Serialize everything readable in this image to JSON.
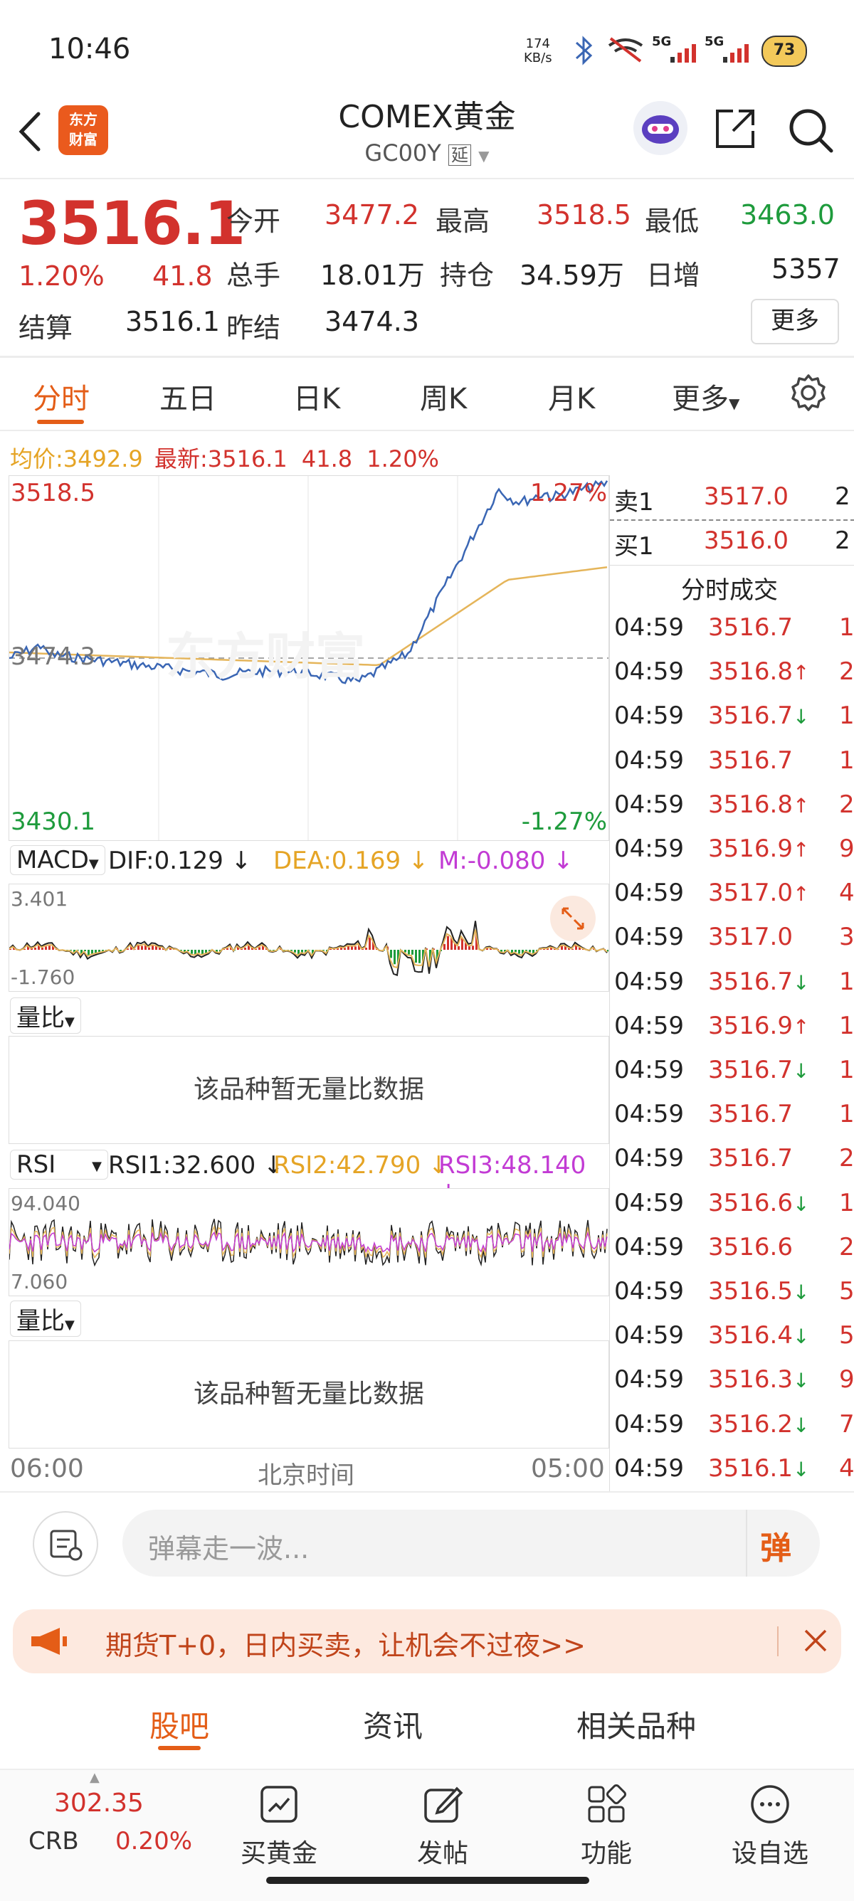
{
  "status_bar": {
    "time": "10:46",
    "net_speed_value": "174",
    "net_speed_unit": "KB/s",
    "signal1": "5G",
    "signal2": "5G",
    "battery": "73"
  },
  "header": {
    "logo_line1": "东方",
    "logo_line2": "财富",
    "title": "COMEX黄金",
    "code": "GC00Y",
    "delay_badge": "延"
  },
  "quote": {
    "price": "3516.1",
    "change_pct": "1.20%",
    "change": "41.8",
    "open_label": "今开",
    "open": "3477.2",
    "high_label": "最高",
    "high": "3518.5",
    "low_label": "最低",
    "low": "3463.0",
    "volume_label": "总手",
    "volume": "18.01万",
    "oi_label": "持仓",
    "oi": "34.59万",
    "daily_inc_label": "日增",
    "daily_inc": "5357",
    "settle_label": "结算",
    "settle": "3516.1",
    "prev_settle_label": "昨结",
    "prev_settle": "3474.3",
    "more_label": "更多"
  },
  "tabs": [
    "分时",
    "五日",
    "日K",
    "周K",
    "月K",
    "更多"
  ],
  "intraday": {
    "avg_label": "均价:",
    "avg": "3492.9",
    "latest_label": "最新:",
    "latest": "3516.1",
    "latest_change": "41.8",
    "latest_pct": "1.20%",
    "y_top": "3518.5",
    "y_mid": "3474.3",
    "y_bottom": "3430.1",
    "pct_top": "1.27%",
    "pct_bottom": "-1.27%",
    "watermark": "东方财富"
  },
  "macd": {
    "name": "MACD",
    "dif": "DIF:0.129",
    "dea": "DEA:0.169",
    "m": "M:-0.080",
    "y_top": "3.401",
    "y_bottom": "-1.760"
  },
  "volratio1": {
    "name": "量比",
    "empty": "该品种暂无量比数据"
  },
  "rsi": {
    "name": "RSI",
    "rsi1": "RSI1:32.600",
    "rsi2": "RSI2:42.790",
    "rsi3": "RSI3:48.140",
    "y_top": "94.040",
    "y_bottom": "7.060"
  },
  "volratio2": {
    "name": "量比",
    "empty": "该品种暂无量比数据"
  },
  "time_axis": {
    "start": "06:00",
    "label": "北京时间",
    "end": "05:00"
  },
  "order_book": {
    "ask_label": "卖1",
    "ask": "3517.0",
    "ask_qty": "2",
    "bid_label": "买1",
    "bid": "3516.0",
    "bid_qty": "2",
    "trades_title": "分时成交"
  },
  "trades": [
    {
      "t": "04:59",
      "p": "3516.7",
      "d": "",
      "q": "1"
    },
    {
      "t": "04:59",
      "p": "3516.8",
      "d": "up",
      "q": "2"
    },
    {
      "t": "04:59",
      "p": "3516.7",
      "d": "down",
      "q": "1"
    },
    {
      "t": "04:59",
      "p": "3516.7",
      "d": "",
      "q": "1"
    },
    {
      "t": "04:59",
      "p": "3516.8",
      "d": "up",
      "q": "2"
    },
    {
      "t": "04:59",
      "p": "3516.9",
      "d": "up",
      "q": "9"
    },
    {
      "t": "04:59",
      "p": "3517.0",
      "d": "up",
      "q": "4"
    },
    {
      "t": "04:59",
      "p": "3517.0",
      "d": "",
      "q": "3"
    },
    {
      "t": "04:59",
      "p": "3516.7",
      "d": "down",
      "q": "1"
    },
    {
      "t": "04:59",
      "p": "3516.9",
      "d": "up",
      "q": "1"
    },
    {
      "t": "04:59",
      "p": "3516.7",
      "d": "down",
      "q": "1"
    },
    {
      "t": "04:59",
      "p": "3516.7",
      "d": "",
      "q": "1"
    },
    {
      "t": "04:59",
      "p": "3516.7",
      "d": "",
      "q": "2"
    },
    {
      "t": "04:59",
      "p": "3516.6",
      "d": "down",
      "q": "1"
    },
    {
      "t": "04:59",
      "p": "3516.6",
      "d": "",
      "q": "2"
    },
    {
      "t": "04:59",
      "p": "3516.5",
      "d": "down",
      "q": "5"
    },
    {
      "t": "04:59",
      "p": "3516.4",
      "d": "down",
      "q": "5"
    },
    {
      "t": "04:59",
      "p": "3516.3",
      "d": "down",
      "q": "9"
    },
    {
      "t": "04:59",
      "p": "3516.2",
      "d": "down",
      "q": "7"
    },
    {
      "t": "04:59",
      "p": "3516.1",
      "d": "down",
      "q": "4"
    }
  ],
  "chat": {
    "placeholder": "弹幕走一波...",
    "send": "弹"
  },
  "banner": {
    "text": "期货T+0，日内买卖，让机会不过夜>>"
  },
  "bottom_tabs": [
    "股吧",
    "资讯",
    "相关品种"
  ],
  "bottom_nav": {
    "crb_value": "302.35",
    "crb_label": "CRB",
    "crb_pct": "0.20%",
    "buy_gold": "买黄金",
    "post": "发帖",
    "function": "功能",
    "watchlist": "设自选"
  },
  "colors": {
    "up": "#d2322d",
    "down": "#1e9b3c",
    "accent": "#e45d17",
    "price_line": "#3a66b4",
    "avg_line": "#e5b55a"
  }
}
